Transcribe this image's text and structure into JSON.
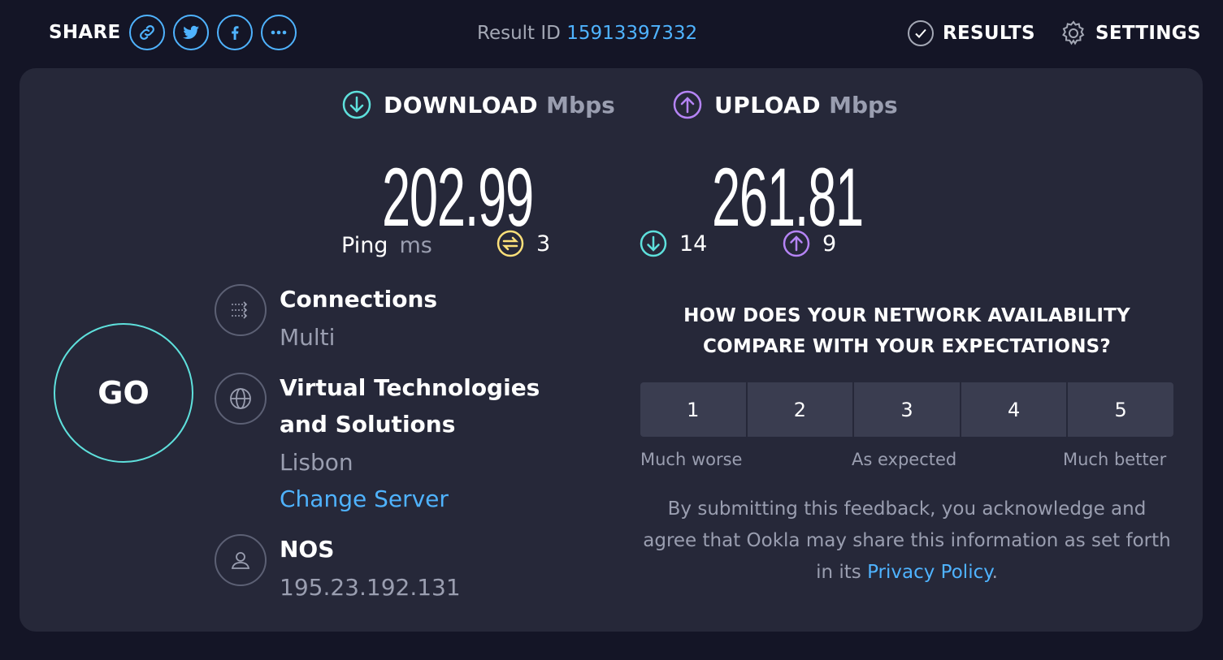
{
  "header": {
    "share_label": "SHARE",
    "share_buttons": [
      {
        "name": "link-icon"
      },
      {
        "name": "twitter-icon"
      },
      {
        "name": "facebook-icon"
      },
      {
        "name": "more-icon"
      }
    ],
    "result_id_label": "Result ID",
    "result_id_value": "15913397332",
    "results_label": "RESULTS",
    "settings_label": "SETTINGS"
  },
  "speeds": {
    "download": {
      "label": "DOWNLOAD",
      "unit": "Mbps",
      "value": "202.99",
      "color": "#5ee0dc"
    },
    "upload": {
      "label": "UPLOAD",
      "unit": "Mbps",
      "value": "261.81",
      "color": "#b584f5"
    }
  },
  "ping": {
    "label": "Ping",
    "unit": "ms",
    "idle": "3",
    "download": "14",
    "upload": "9",
    "idle_color": "#fce07a"
  },
  "go_label": "GO",
  "connections": {
    "title": "Connections",
    "value": "Multi"
  },
  "server": {
    "title": "Virtual Technologies and Solutions",
    "location": "Lisbon",
    "change_label": "Change Server"
  },
  "isp": {
    "name": "NOS",
    "ip": "195.23.192.131"
  },
  "survey": {
    "question": "HOW DOES YOUR NETWORK AVAILABILITY COMPARE WITH YOUR EXPECTATIONS?",
    "ratings": [
      "1",
      "2",
      "3",
      "4",
      "5"
    ],
    "scale_low": "Much worse",
    "scale_mid": "As expected",
    "scale_high": "Much better",
    "disclaimer_text": "By submitting this feedback, you acknowledge and agree that Ookla may share this information as set forth in its",
    "privacy_link": "Privacy Policy",
    "disclaimer_end": "."
  }
}
